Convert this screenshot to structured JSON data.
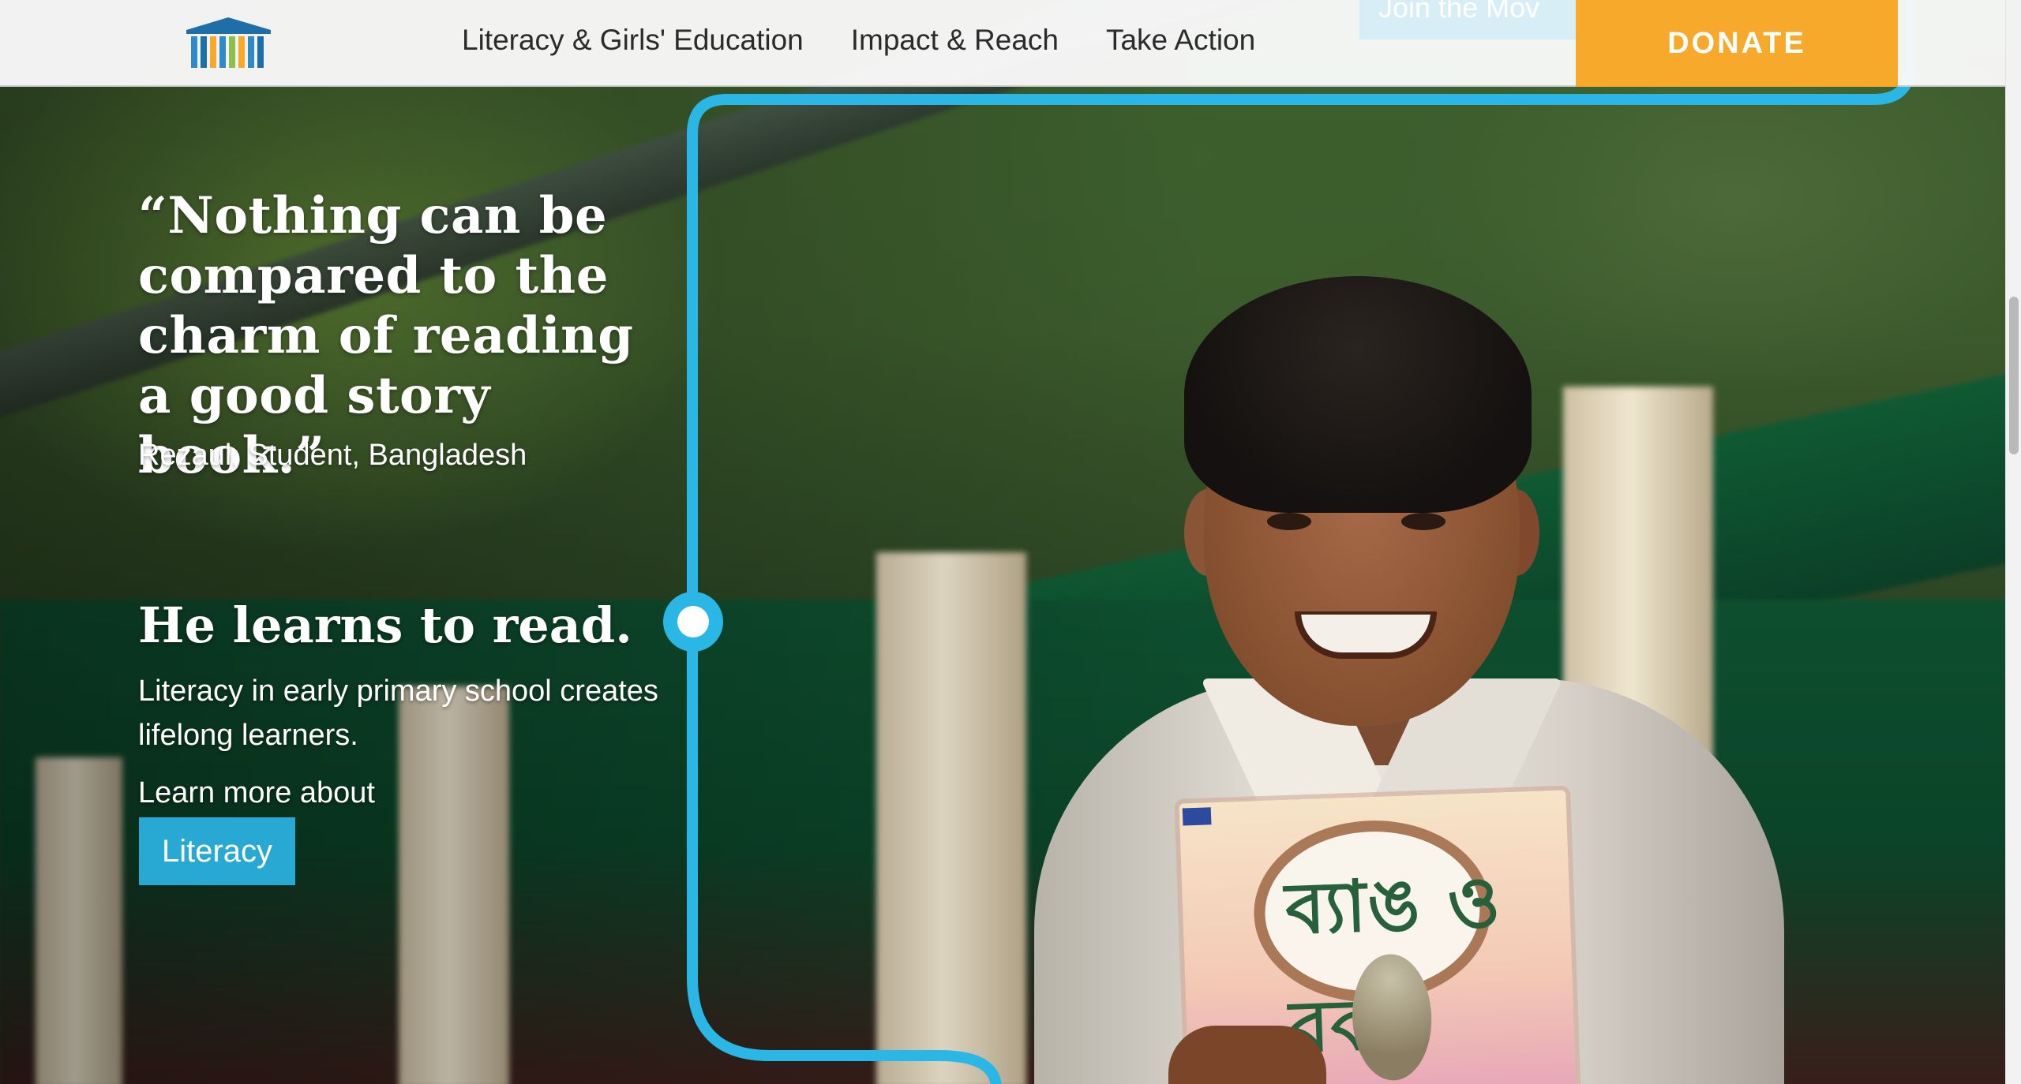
{
  "header": {
    "logo_icon": "library-columns-logo",
    "nav": [
      {
        "label": "Literacy & Girls' Education"
      },
      {
        "label": "Impact & Reach"
      },
      {
        "label": "Take Action"
      }
    ],
    "join_label": "Join the Mov",
    "donate_label": "DONATE"
  },
  "hero": {
    "quote": "“Nothing can be compared to the charm of reading a good story book.”",
    "attribution": "Rezaul, Student, Bangladesh",
    "headline": "He learns to read.",
    "body": "Literacy in early primary school creates lifelong learners.",
    "learn_more": "Learn more about",
    "cta_label": "Literacy",
    "book_title": "ব্যাঙ ও বক"
  },
  "colors": {
    "accent_blue": "#28a9d3",
    "line_blue": "#2ab7e6",
    "donate_orange": "#f7a92b"
  }
}
